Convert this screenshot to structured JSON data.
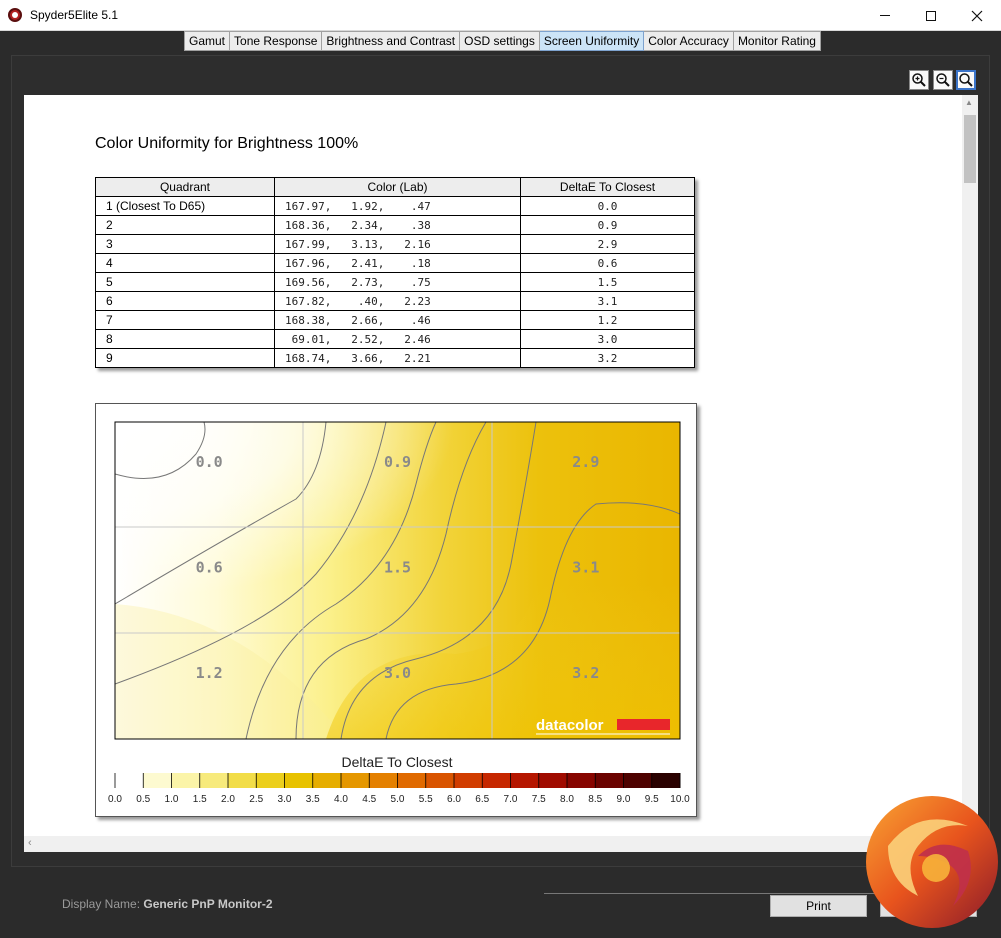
{
  "window": {
    "title": "Spyder5Elite 5.1"
  },
  "tabs": [
    {
      "label": "Gamut",
      "active": false
    },
    {
      "label": "Tone Response",
      "active": false
    },
    {
      "label": "Brightness and Contrast",
      "active": false
    },
    {
      "label": "OSD settings",
      "active": false
    },
    {
      "label": "Screen Uniformity",
      "active": true
    },
    {
      "label": "Color Accuracy",
      "active": false
    },
    {
      "label": "Monitor Rating",
      "active": false
    }
  ],
  "toolbar": {
    "zoom_in": "zoom-in-icon",
    "zoom_out": "zoom-out-icon",
    "zoom_fit": "zoom-fit-icon"
  },
  "report": {
    "title": "Color Uniformity for Brightness 100%",
    "table": {
      "headers": [
        "Quadrant",
        "Color (Lab)",
        "DeltaE To Closest"
      ],
      "rows": [
        {
          "quadrant": "1 (Closest To D65)",
          "lab": "167.97,   1.92,    .47",
          "delta": "0.0"
        },
        {
          "quadrant": "2",
          "lab": "168.36,   2.34,    .38",
          "delta": "0.9"
        },
        {
          "quadrant": "3",
          "lab": "167.99,   3.13,   2.16",
          "delta": "2.9"
        },
        {
          "quadrant": "4",
          "lab": "167.96,   2.41,    .18",
          "delta": "0.6"
        },
        {
          "quadrant": "5",
          "lab": "169.56,   2.73,    .75",
          "delta": "1.5"
        },
        {
          "quadrant": "6",
          "lab": "167.82,    .40,   2.23",
          "delta": "3.1"
        },
        {
          "quadrant": "7",
          "lab": "168.38,   2.66,    .46",
          "delta": "1.2"
        },
        {
          "quadrant": "8",
          "lab": " 69.01,   2.52,   2.46",
          "delta": "3.0"
        },
        {
          "quadrant": "9",
          "lab": "168.74,   3.66,   2.21",
          "delta": "3.2"
        }
      ]
    }
  },
  "chart_data": {
    "type": "heatmap",
    "grid": [
      [
        "0.0",
        "0.9",
        "2.9"
      ],
      [
        "0.6",
        "1.5",
        "3.1"
      ],
      [
        "1.2",
        "3.0",
        "3.2"
      ]
    ],
    "values": [
      [
        0.0,
        0.9,
        2.9
      ],
      [
        0.6,
        1.5,
        3.1
      ],
      [
        1.2,
        3.0,
        3.2
      ]
    ],
    "colorbar": {
      "title": "DeltaE To Closest",
      "range": [
        0,
        10
      ],
      "ticks": [
        "0.0",
        "0.5",
        "1.0",
        "1.5",
        "2.0",
        "2.5",
        "3.0",
        "3.5",
        "4.0",
        "4.5",
        "5.0",
        "5.5",
        "6.0",
        "6.5",
        "7.0",
        "7.5",
        "8.0",
        "8.5",
        "9.0",
        "9.5",
        "10.0"
      ],
      "colors": [
        "#ffffff",
        "#fdfad0",
        "#fbf4a8",
        "#f7ea7c",
        "#f2dd48",
        "#eccf1c",
        "#e8c200",
        "#e6ad00",
        "#e59700",
        "#e48000",
        "#e06a00",
        "#d95400",
        "#d13d00",
        "#c62700",
        "#b51600",
        "#a00b00",
        "#870500",
        "#6b0300",
        "#4e0200",
        "#2a0100"
      ]
    },
    "watermark": "datacolor"
  },
  "footer": {
    "display_label": "Display Name:",
    "display_value": "Generic PnP Monitor-2",
    "print_label": "Print"
  },
  "colors": {
    "accent": "#cce4f7",
    "heat_low": "#ffffff",
    "heat_high": "#eab700"
  }
}
